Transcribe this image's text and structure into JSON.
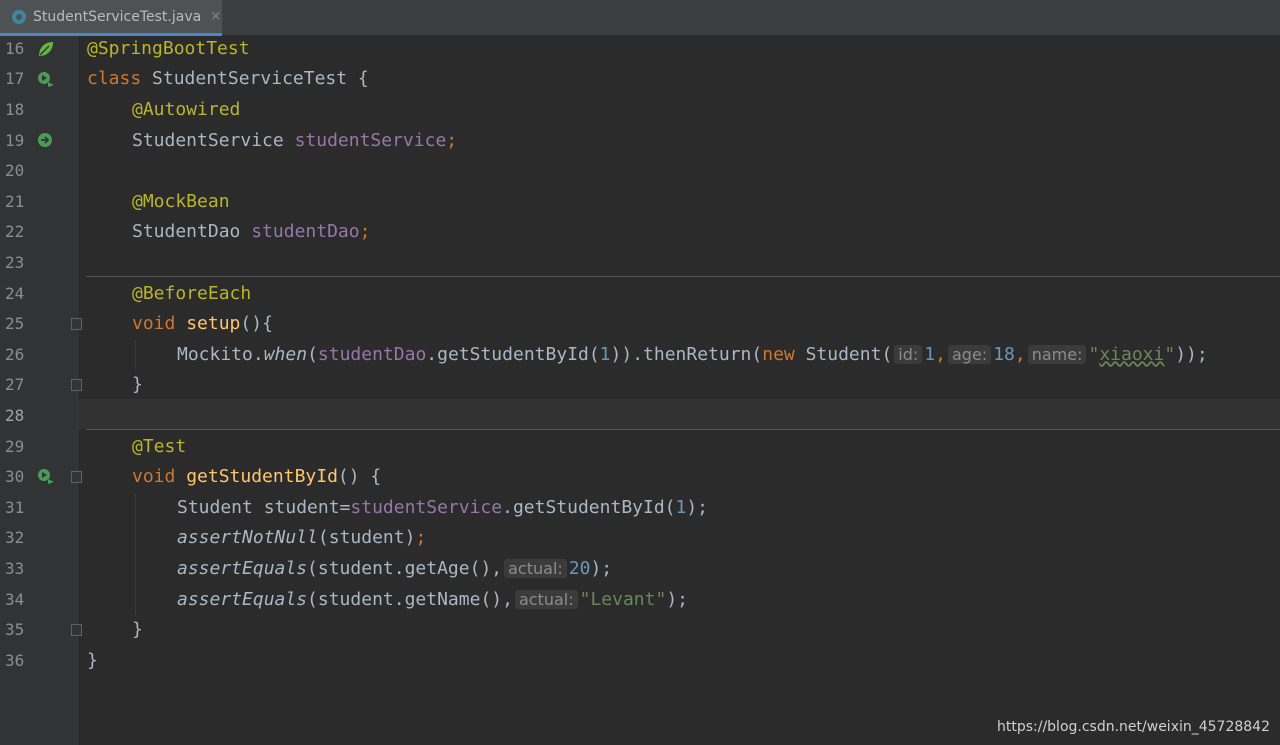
{
  "tab": {
    "label": "StudentServiceTest.java",
    "close": "×",
    "icon": "java-class-icon"
  },
  "gutter": {
    "line_numbers": [
      "16",
      "17",
      "18",
      "19",
      "20",
      "21",
      "22",
      "23",
      "24",
      "25",
      "26",
      "27",
      "28",
      "29",
      "30",
      "31",
      "32",
      "33",
      "34",
      "35",
      "36"
    ]
  },
  "code": {
    "l16": {
      "a": "@SpringBootTest"
    },
    "l17": {
      "kw": "class",
      "rest": " StudentServiceTest {"
    },
    "l18": {
      "a": "@Autowired"
    },
    "l19": {
      "type": "StudentService ",
      "field": "studentService",
      "semi": ";"
    },
    "l21": {
      "a": "@MockBean"
    },
    "l22": {
      "type": "StudentDao ",
      "field": "studentDao",
      "semi": ";"
    },
    "l24": {
      "a": "@BeforeEach"
    },
    "l25": {
      "kw": "void",
      "fn": "setup",
      "rest": "(){"
    },
    "l26": {
      "p1": "Mockito.",
      "when": "when",
      "p2": "(",
      "field": "studentDao",
      "p3": ".getStudentById(",
      "n1": "1",
      "p4": ")).thenReturn(",
      "kw": "new",
      "p5": " Student(",
      "h1": "id:",
      "v1": "1",
      "c1": ",",
      "h2": "age:",
      "v2": "18",
      "c2": ",",
      "h3": "name:",
      "q1": "\"",
      "v3": "xiaoxi",
      "q2": "\"",
      "end": "));"
    },
    "l27": {
      "rest": "}"
    },
    "l29": {
      "a": "@Test"
    },
    "l30": {
      "kw": "void",
      "fn": "getStudentById",
      "rest": "() {"
    },
    "l31": {
      "p1": "Student student=",
      "field": "studentService",
      "p2": ".getStudentById(",
      "n1": "1",
      "end": ");"
    },
    "l32": {
      "it": "assertNotNull",
      "p1": "(student)",
      "semi": ";"
    },
    "l33": {
      "it": "assertEquals",
      "p1": "(student.getAge(),",
      "h": "actual:",
      "n": "20",
      "end": ");"
    },
    "l34": {
      "it": "assertEquals",
      "p1": "(student.getName(),",
      "h": "actual:",
      "s": "\"Levant\"",
      "end": ");"
    },
    "l35": {
      "rest": "}"
    },
    "l36": {
      "rest": "}"
    }
  },
  "watermark": "https://blog.csdn.net/weixin_45728842",
  "colors": {
    "background": "#2b2b2b",
    "keyword": "#cc7832",
    "annotation": "#bbb529",
    "field": "#9876aa",
    "method": "#ffc66d",
    "number": "#6897bb",
    "string": "#6a8759"
  }
}
